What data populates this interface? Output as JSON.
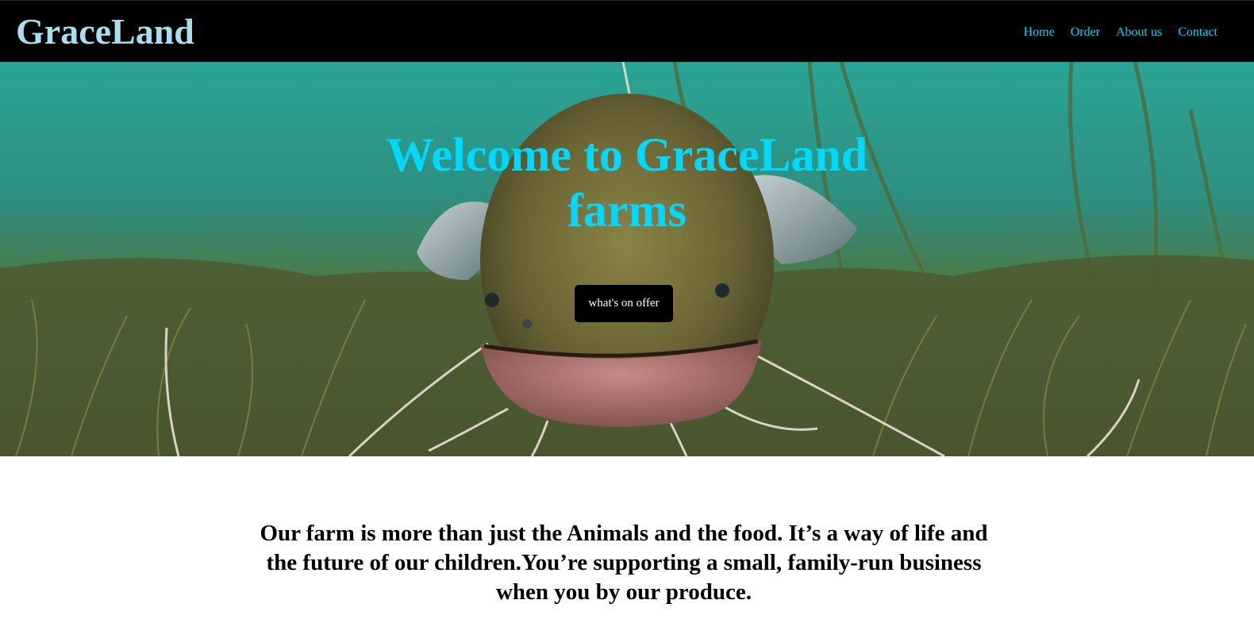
{
  "brand": {
    "name": "GraceLand"
  },
  "nav": {
    "items": [
      {
        "label": "Home"
      },
      {
        "label": "Order"
      },
      {
        "label": "About us"
      },
      {
        "label": "Contact"
      }
    ]
  },
  "hero": {
    "title": "Welcome to GraceLand farms",
    "button_label": "what's on offer",
    "image_icon": "catfish-underwater-photo"
  },
  "intro": {
    "text": "Our farm is more than just the Animals and the food. It’s a way of life and the future of our children.You’re supporting a small, family-run business when you by our produce."
  },
  "colors": {
    "navbar_bg": "#000000",
    "brand": "#a8dff0",
    "nav_link": "#00d4ff",
    "hero_title": "#00d8ff",
    "button_bg": "#000000",
    "button_text": "#ffffff"
  }
}
